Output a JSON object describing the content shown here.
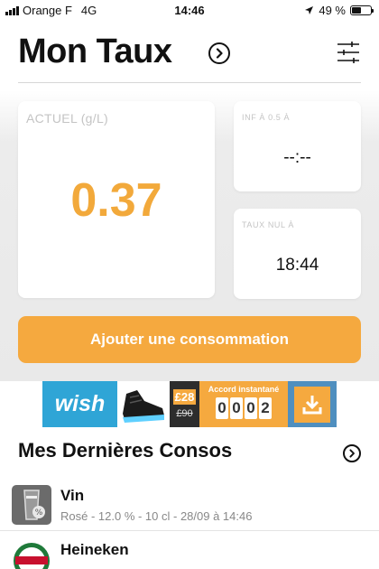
{
  "status_bar": {
    "carrier": "Orange F",
    "network": "4G",
    "time": "14:46",
    "battery_percent": "49 %",
    "battery_level": 0.49
  },
  "header": {
    "title": "Mon Taux"
  },
  "cards": {
    "current": {
      "label": "ACTUEL (g/L)",
      "value": "0.37"
    },
    "below_limit": {
      "label": "INF À 0.5 À",
      "value": "--:--"
    },
    "zero_rate": {
      "label": "TAUX NUL À",
      "value": "18:44"
    }
  },
  "add_button": {
    "label": "Ajouter une consommation"
  },
  "ad": {
    "brand": "wish",
    "new_price": "£28",
    "old_price": "£90",
    "countdown_title": "Accord instantané",
    "countdown_digits": [
      "0",
      "0",
      "0",
      "2"
    ]
  },
  "last_drinks": {
    "title": "Mes Dernières Consos",
    "items": [
      {
        "name": "Vin",
        "details": "Rosé - 12.0 % - 10 cl - 28/09 à 14:46"
      },
      {
        "name": "Heineken",
        "details": ""
      }
    ]
  },
  "colors": {
    "accent": "#f5a93f",
    "value_orange": "#f2a93b",
    "panel_gray": "#e9e9e9",
    "ad_blue": "#2fa5d6"
  }
}
